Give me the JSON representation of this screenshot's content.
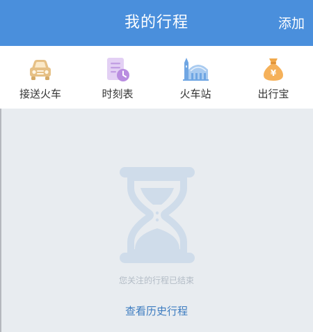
{
  "header": {
    "title": "我的行程",
    "add_label": "添加"
  },
  "toolbar": {
    "items": [
      {
        "label": "接送火车",
        "icon": "car-icon",
        "color": "#e8c48a"
      },
      {
        "label": "时刻表",
        "icon": "timetable-icon",
        "color": "#c9a6e6"
      },
      {
        "label": "火车站",
        "icon": "train-station-icon",
        "color": "#7fb2e8"
      },
      {
        "label": "出行宝",
        "icon": "money-bag-icon",
        "color": "#f5b35a"
      }
    ]
  },
  "empty_state": {
    "icon": "hourglass-icon",
    "message": "您关注的行程已结束",
    "history_link": "查看历史行程"
  },
  "colors": {
    "header_bg": "#4a8fdc",
    "page_bg": "#e8ecf0",
    "link": "#3d7cc0"
  }
}
